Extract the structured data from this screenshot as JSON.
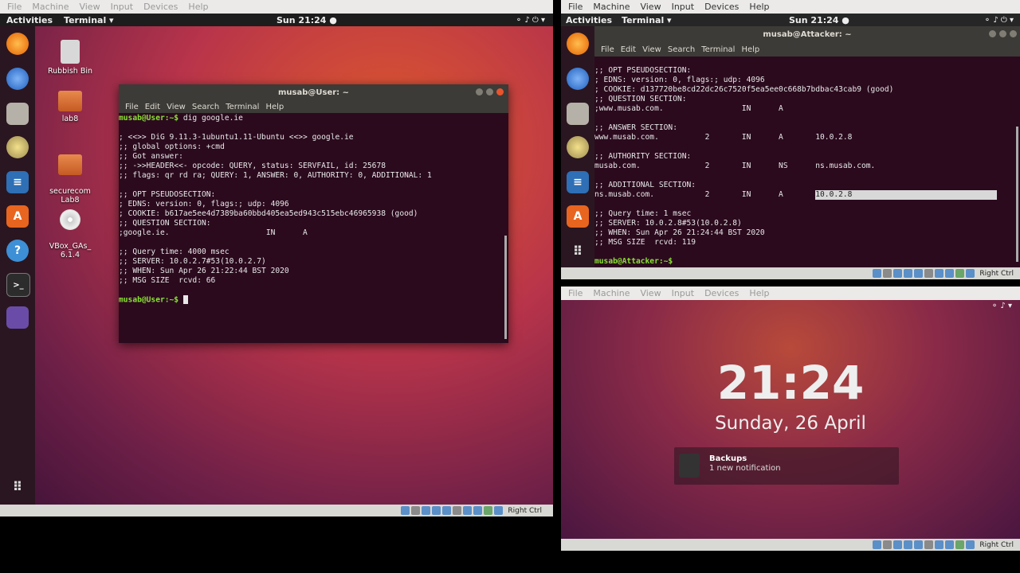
{
  "left_vm": {
    "menu": [
      "File",
      "Machine",
      "View",
      "Input",
      "Devices",
      "Help"
    ],
    "status_key": "Right Ctrl",
    "topbar": {
      "activities": "Activities",
      "app": "Terminal ▾",
      "clock": "Sun 21:24 ●"
    },
    "desktop_icons": [
      "Rubbish Bin",
      "lab8",
      "securecom\nLab8",
      "VBox_GAs_\n6.1.4"
    ],
    "terminal": {
      "title": "musab@User: ~",
      "menu": [
        "File",
        "Edit",
        "View",
        "Search",
        "Terminal",
        "Help"
      ],
      "prompt": "musab@User:~$",
      "lines": [
        {
          "p": "musab@User:~$",
          "t": " dig google.ie"
        },
        {
          "t": ""
        },
        {
          "t": "; <<>> DiG 9.11.3-1ubuntu1.11-Ubuntu <<>> google.ie"
        },
        {
          "t": ";; global options: +cmd"
        },
        {
          "t": ";; Got answer:"
        },
        {
          "t": ";; ->>HEADER<<- opcode: QUERY, status: SERVFAIL, id: 25678"
        },
        {
          "t": ";; flags: qr rd ra; QUERY: 1, ANSWER: 0, AUTHORITY: 0, ADDITIONAL: 1"
        },
        {
          "t": ""
        },
        {
          "t": ";; OPT PSEUDOSECTION:"
        },
        {
          "t": "; EDNS: version: 0, flags:; udp: 4096"
        },
        {
          "t": "; COOKIE: b617ae5ee4d7389ba60bbd405ea5ed943c515ebc46965938 (good)"
        },
        {
          "t": ";; QUESTION SECTION:"
        },
        {
          "t": ";google.ie.                     IN      A"
        },
        {
          "t": ""
        },
        {
          "t": ";; Query time: 4000 msec"
        },
        {
          "t": ";; SERVER: 10.0.2.7#53(10.0.2.7)"
        },
        {
          "t": ";; WHEN: Sun Apr 26 21:22:44 BST 2020"
        },
        {
          "t": ";; MSG SIZE  rcvd: 66"
        },
        {
          "t": ""
        },
        {
          "p": "musab@User:~$",
          "t": " "
        }
      ]
    }
  },
  "right_top_vm": {
    "menu": [
      "File",
      "Machine",
      "View",
      "Input",
      "Devices",
      "Help"
    ],
    "status_key": "Right Ctrl",
    "topbar": {
      "activities": "Activities",
      "app": "Terminal ▾",
      "clock": "Sun 21:24 ●"
    },
    "terminal": {
      "title": "musab@Attacker: ~",
      "menu": [
        "File",
        "Edit",
        "View",
        "Search",
        "Terminal",
        "Help"
      ],
      "lines": [
        {
          "t": ";; OPT PSEUDOSECTION:"
        },
        {
          "t": "; EDNS: version: 0, flags:; udp: 4096"
        },
        {
          "t": "; COOKIE: d137720be8cd22dc26c7520f5ea5ee0c668b7bdbac43cab9 (good)"
        },
        {
          "t": ";; QUESTION SECTION:"
        },
        {
          "t": ";www.musab.com.                 IN      A"
        },
        {
          "t": ""
        },
        {
          "t": ";; ANSWER SECTION:"
        },
        {
          "t": "www.musab.com.          2       IN      A       10.0.2.8"
        },
        {
          "t": ""
        },
        {
          "t": ";; AUTHORITY SECTION:"
        },
        {
          "t": "musab.com.              2       IN      NS      ns.musab.com."
        },
        {
          "t": ""
        },
        {
          "t": ";; ADDITIONAL SECTION:"
        },
        {
          "t": "ns.musab.com.           2       IN      A       ",
          "h": "10.0.2.8"
        },
        {
          "t": ""
        },
        {
          "t": ";; Query time: 1 msec"
        },
        {
          "t": ";; SERVER: 10.0.2.8#53(10.0.2.8)"
        },
        {
          "t": ";; WHEN: Sun Apr 26 21:24:44 BST 2020"
        },
        {
          "t": ";; MSG SIZE  rcvd: 119"
        },
        {
          "t": ""
        },
        {
          "p": "musab@Attacker:~$",
          "t": ""
        }
      ]
    }
  },
  "right_bottom_vm": {
    "menu": [
      "File",
      "Machine",
      "View",
      "Input",
      "Devices",
      "Help"
    ],
    "status_key": "Right Ctrl",
    "lock": {
      "time": "21:24",
      "date": "Sunday, 26 April",
      "notif_title": "Backups",
      "notif_body": "1 new notification"
    }
  },
  "colors": {
    "ubuntu_bg": "#8a2a3a",
    "terminal_bg": "#2b0a1e",
    "prompt": "#8ae234"
  }
}
